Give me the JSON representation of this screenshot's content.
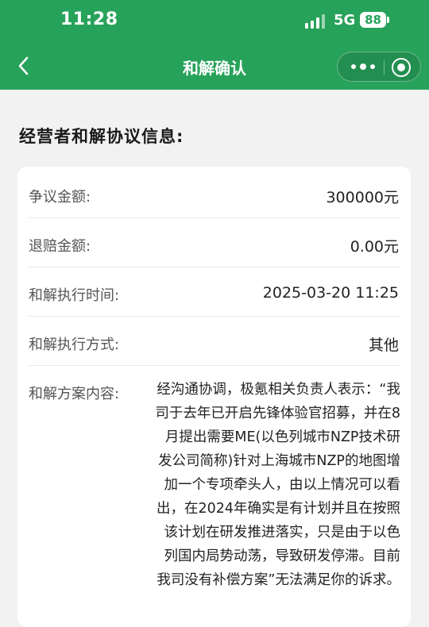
{
  "status_bar": {
    "time": "11:28",
    "network": "5G",
    "battery": "88"
  },
  "nav": {
    "back_icon": "chevron-left-icon",
    "title": "和解确认",
    "more_icon": "more-dots-icon",
    "close_icon": "target-icon"
  },
  "section": {
    "title": "经营者和解协议信息:"
  },
  "info": {
    "rows": [
      {
        "label": "争议金额:",
        "value": "300000元"
      },
      {
        "label": "退赔金额:",
        "value": "0.00元"
      },
      {
        "label": "和解执行时间:",
        "value": "2025-03-20 11:25"
      },
      {
        "label": "和解执行方式:",
        "value": "其他"
      }
    ],
    "plan_label": "和解方案内容:",
    "plan_text": "经沟通协调，极氪相关负责人表示：“我司于去年已开启先锋体验官招募，并在8月提出需要ME(以色列城市NZP技术研发公司简称)针对上海城市NZP的地图增加一个专项牵头人，由以上情况可以看出，在2024年确实是有计划并且在按照该计划在研发推进落实，只是由于以色列国内局势动荡，导致研发停滞。目前我司没有补偿方案”无法满足你的诉求。"
  },
  "colors": {
    "brand_green": "#27a25a",
    "page_bg": "#f2f2f2"
  }
}
